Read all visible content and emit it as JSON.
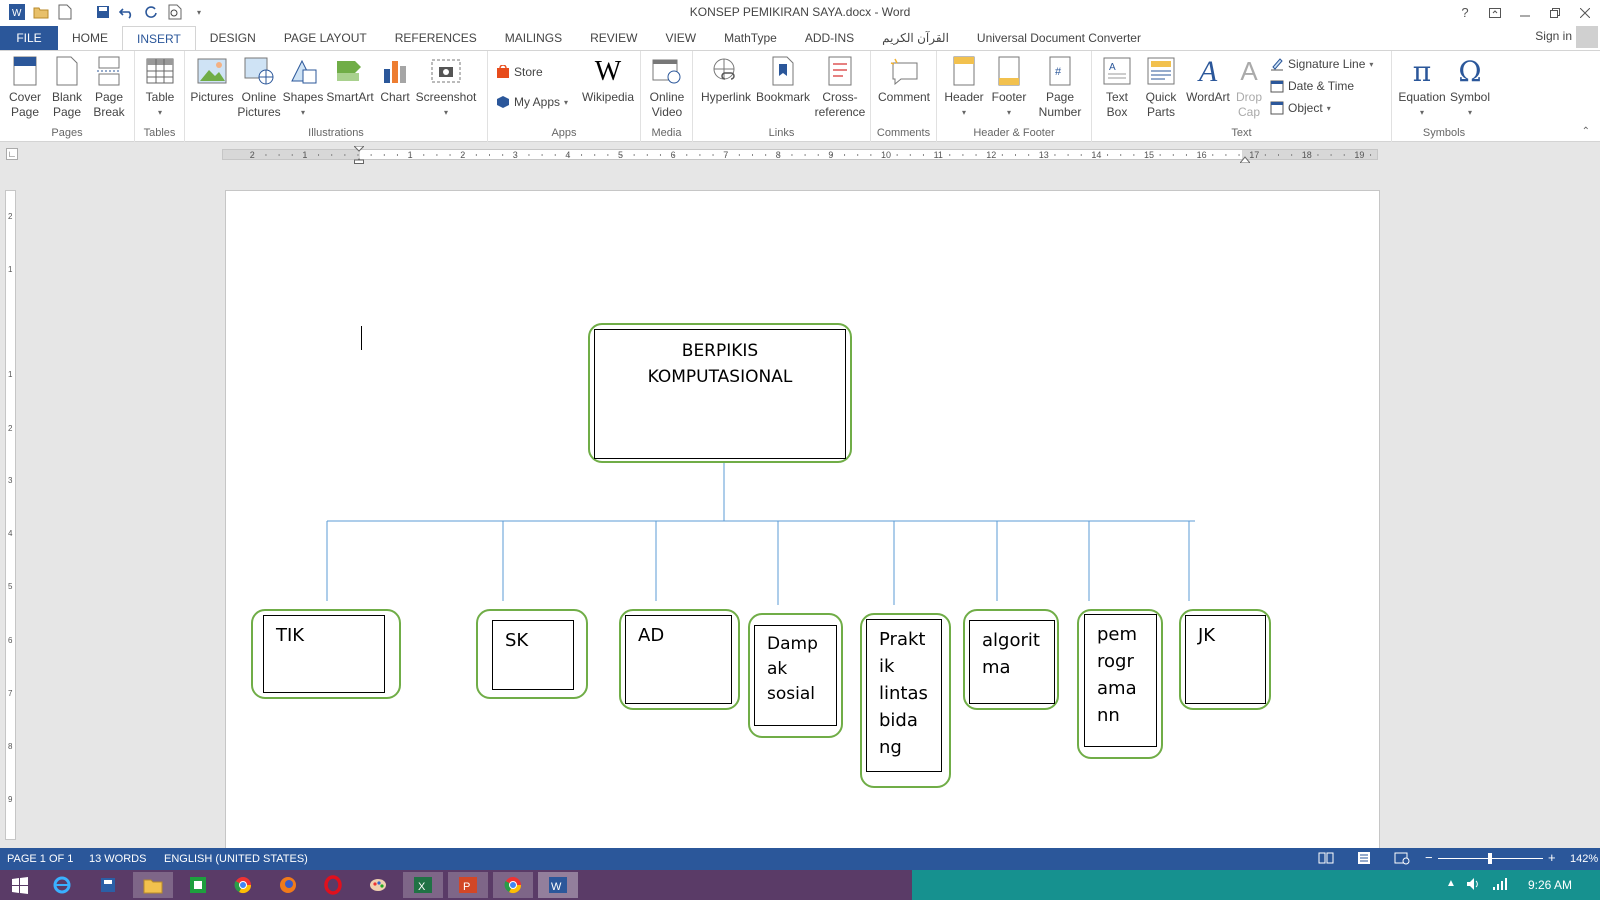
{
  "window": {
    "title": "KONSEP PEMIKIRAN SAYA.docx - Word",
    "help": "?",
    "controls": [
      "ribbon-display-options",
      "minimize",
      "restore",
      "close"
    ]
  },
  "tabs": [
    "FILE",
    "HOME",
    "INSERT",
    "DESIGN",
    "PAGE LAYOUT",
    "REFERENCES",
    "MAILINGS",
    "REVIEW",
    "VIEW",
    "MathType",
    "ADD-INS",
    "القرآن الكريم",
    "Universal Document Converter"
  ],
  "active_tab": "INSERT",
  "sign_in": "Sign in",
  "ribbon": {
    "pages": {
      "label": "Pages",
      "cover_page": "Cover\nPage",
      "blank_page": "Blank\nPage",
      "page_break": "Page\nBreak"
    },
    "tables": {
      "label": "Tables",
      "table": "Table"
    },
    "illustrations": {
      "label": "Illustrations",
      "pictures": "Pictures",
      "online_pictures": "Online\nPictures",
      "shapes": "Shapes",
      "smartart": "SmartArt",
      "chart": "Chart",
      "screenshot": "Screenshot"
    },
    "apps": {
      "label": "Apps",
      "store": "Store",
      "my_apps": "My Apps",
      "wikipedia": "Wikipedia"
    },
    "media": {
      "label": "Media",
      "online_video": "Online\nVideo"
    },
    "links": {
      "label": "Links",
      "hyperlink": "Hyperlink",
      "bookmark": "Bookmark",
      "cross_reference": "Cross-\nreference"
    },
    "comments": {
      "label": "Comments",
      "comment": "Comment"
    },
    "header_footer": {
      "label": "Header & Footer",
      "header": "Header",
      "footer": "Footer",
      "page_number": "Page\nNumber"
    },
    "text": {
      "label": "Text",
      "text_box": "Text\nBox",
      "quick_parts": "Quick\nParts",
      "wordart": "WordArt",
      "drop_cap": "Drop\nCap",
      "signature_line": "Signature Line",
      "date_time": "Date & Time",
      "object": "Object"
    },
    "symbols": {
      "label": "Symbols",
      "equation": "Equation",
      "symbol": "Symbol"
    }
  },
  "ruler": {
    "h_numbers": [
      "2",
      "1",
      "1",
      "2",
      "3",
      "4",
      "5",
      "6",
      "7",
      "8",
      "9",
      "10",
      "11",
      "12",
      "13",
      "14",
      "15",
      "16",
      "17",
      "18",
      "19"
    ],
    "v_numbers": [
      "2",
      "1",
      "1",
      "2",
      "3",
      "4",
      "5",
      "6",
      "7",
      "8",
      "9"
    ]
  },
  "diagram": {
    "root": {
      "label": "BERPIKIS\nKOMPUTASIONAL"
    },
    "children": [
      {
        "label": "TIK"
      },
      {
        "label": "SK"
      },
      {
        "label": "AD"
      },
      {
        "label": "Damp\nak\nsosial"
      },
      {
        "label": "Prakt\nik\nlintas\nbida\nng"
      },
      {
        "label": "algorit\nma"
      },
      {
        "label": "pem\nrogr\nama\nnn"
      },
      {
        "label": "JK"
      }
    ]
  },
  "status": {
    "page": "PAGE 1 OF 1",
    "words": "13 WORDS",
    "language": "ENGLISH (UNITED STATES)",
    "zoom": "142%",
    "zoom_minus": "−",
    "zoom_plus": "+"
  },
  "taskbar": {
    "apps": [
      "start",
      "internet-explorer",
      "media-player",
      "file-explorer",
      "excel-green",
      "chrome",
      "firefox",
      "opera",
      "paint",
      "excel",
      "powerpoint",
      "chrome-2",
      "word"
    ],
    "time": "9:26 AM"
  },
  "colors": {
    "accent": "#2b579a",
    "node_border": "#70ad47",
    "connector": "#5b9bd5"
  }
}
